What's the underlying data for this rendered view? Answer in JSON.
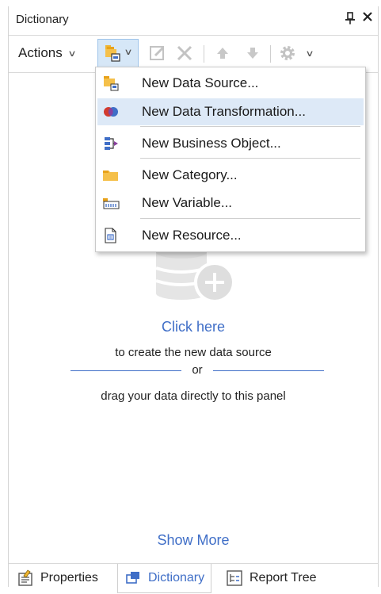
{
  "panel": {
    "title": "Dictionary",
    "pin_glyph": "⨅",
    "close_glyph": "✕"
  },
  "toolbar": {
    "actions_label": "Actions",
    "icons": [
      "add-dropdown-icon",
      "edit-icon",
      "delete-icon",
      "move-up-icon",
      "move-down-icon",
      "settings-icon"
    ]
  },
  "menu": {
    "items": [
      {
        "label": "New Data Source...",
        "icon": "data-source-icon"
      },
      {
        "label": "New Data Transformation...",
        "icon": "data-transformation-icon",
        "highlighted": true
      },
      {
        "label": "New Business Object...",
        "icon": "business-object-icon"
      },
      {
        "label": "New Category...",
        "icon": "folder-icon"
      },
      {
        "label": "New Variable...",
        "icon": "variable-icon"
      },
      {
        "label": "New Resource...",
        "icon": "resource-icon"
      }
    ]
  },
  "empty_state": {
    "link": "Click here",
    "hint": "to create the new data source",
    "or": "or",
    "drag_hint": "drag your data directly to this panel",
    "show_more": "Show More"
  },
  "tabs": [
    {
      "label": "Properties",
      "icon": "properties-icon",
      "active": false
    },
    {
      "label": "Dictionary",
      "icon": "dictionary-icon",
      "active": true
    },
    {
      "label": "Report Tree",
      "icon": "report-tree-icon",
      "active": false
    }
  ],
  "colors": {
    "accent": "#3f6ec7",
    "menu_highlight": "#dde9f7",
    "button_active": "#d6e7f7"
  }
}
